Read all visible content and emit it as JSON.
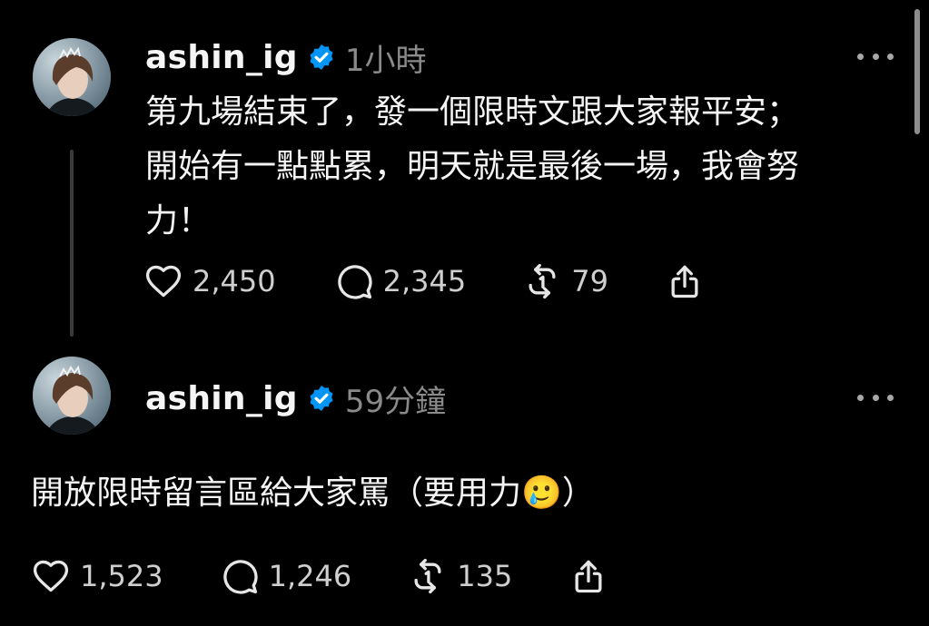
{
  "posts": [
    {
      "username": "ashin_ig",
      "time": "1小時",
      "text_lines": [
        "第九場結束了，發一個限時文跟大家報平安；",
        "開始有一點點累，明天就是最後一場，我會努",
        "力！"
      ],
      "likes": "2,450",
      "replies": "2,345",
      "reposts": "79"
    },
    {
      "username": "ashin_ig",
      "time": "59分鐘",
      "text_lines": [
        "開放限時留言區給大家罵（要用力🥲）"
      ],
      "likes": "1,523",
      "replies": "1,246",
      "reposts": "135"
    }
  ],
  "icons": {
    "verified": "verified-badge-icon",
    "more": "more-options-icon",
    "like": "heart-icon",
    "reply": "comment-icon",
    "repost": "repost-icon",
    "share": "share-icon"
  },
  "colors": {
    "background": "#000000",
    "verified": "#0095f6",
    "muted": "#8a8a8a"
  }
}
